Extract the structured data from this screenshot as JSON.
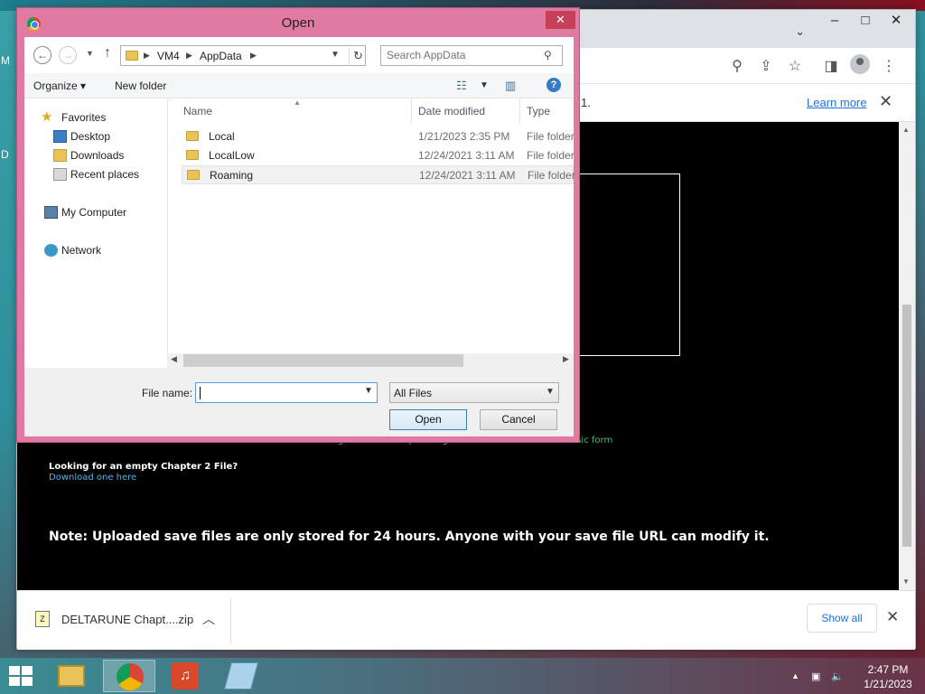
{
  "desktop": {
    "left_letters": [
      "M",
      "D"
    ]
  },
  "chrome": {
    "infobar_text": "1.",
    "learn_more": "Learn more",
    "content": {
      "green_text": "Having trouble with uploading? Click here to switch to classic form",
      "empty_file_question": "Looking for an empty Chapter 2 File?",
      "download_link": "Download one here",
      "note": "Note: Uploaded save files are only stored for 24 hours. Anyone with your save file URL can modify it."
    },
    "downloads": {
      "file_name": "DELTARUNE Chapt....zip",
      "show_all": "Show all"
    }
  },
  "dialog": {
    "title": "Open",
    "breadcrumb": [
      "VM4",
      "AppData"
    ],
    "search_placeholder": "Search AppData",
    "organize": "Organize",
    "new_folder": "New folder",
    "nav": {
      "favorites": "Favorites",
      "desktop": "Desktop",
      "downloads": "Downloads",
      "recent": "Recent places",
      "computer": "My Computer",
      "network": "Network"
    },
    "columns": {
      "name": "Name",
      "date": "Date modified",
      "type": "Type"
    },
    "rows": [
      {
        "name": "Local",
        "date": "1/21/2023 2:35 PM",
        "type": "File folder"
      },
      {
        "name": "LocalLow",
        "date": "12/24/2021 3:11 AM",
        "type": "File folder"
      },
      {
        "name": "Roaming",
        "date": "12/24/2021 3:11 AM",
        "type": "File folder"
      }
    ],
    "file_name_label": "File name:",
    "file_name_value": "",
    "file_type": "All Files",
    "open_button": "Open",
    "cancel_button": "Cancel"
  },
  "taskbar": {
    "time": "2:47 PM",
    "date": "1/21/2023"
  },
  "colors": {
    "dialog_frame": "#e17aa3",
    "dialog_close": "#c7405a",
    "link_blue": "#1a73e8",
    "green_text": "#3fbf7f"
  }
}
